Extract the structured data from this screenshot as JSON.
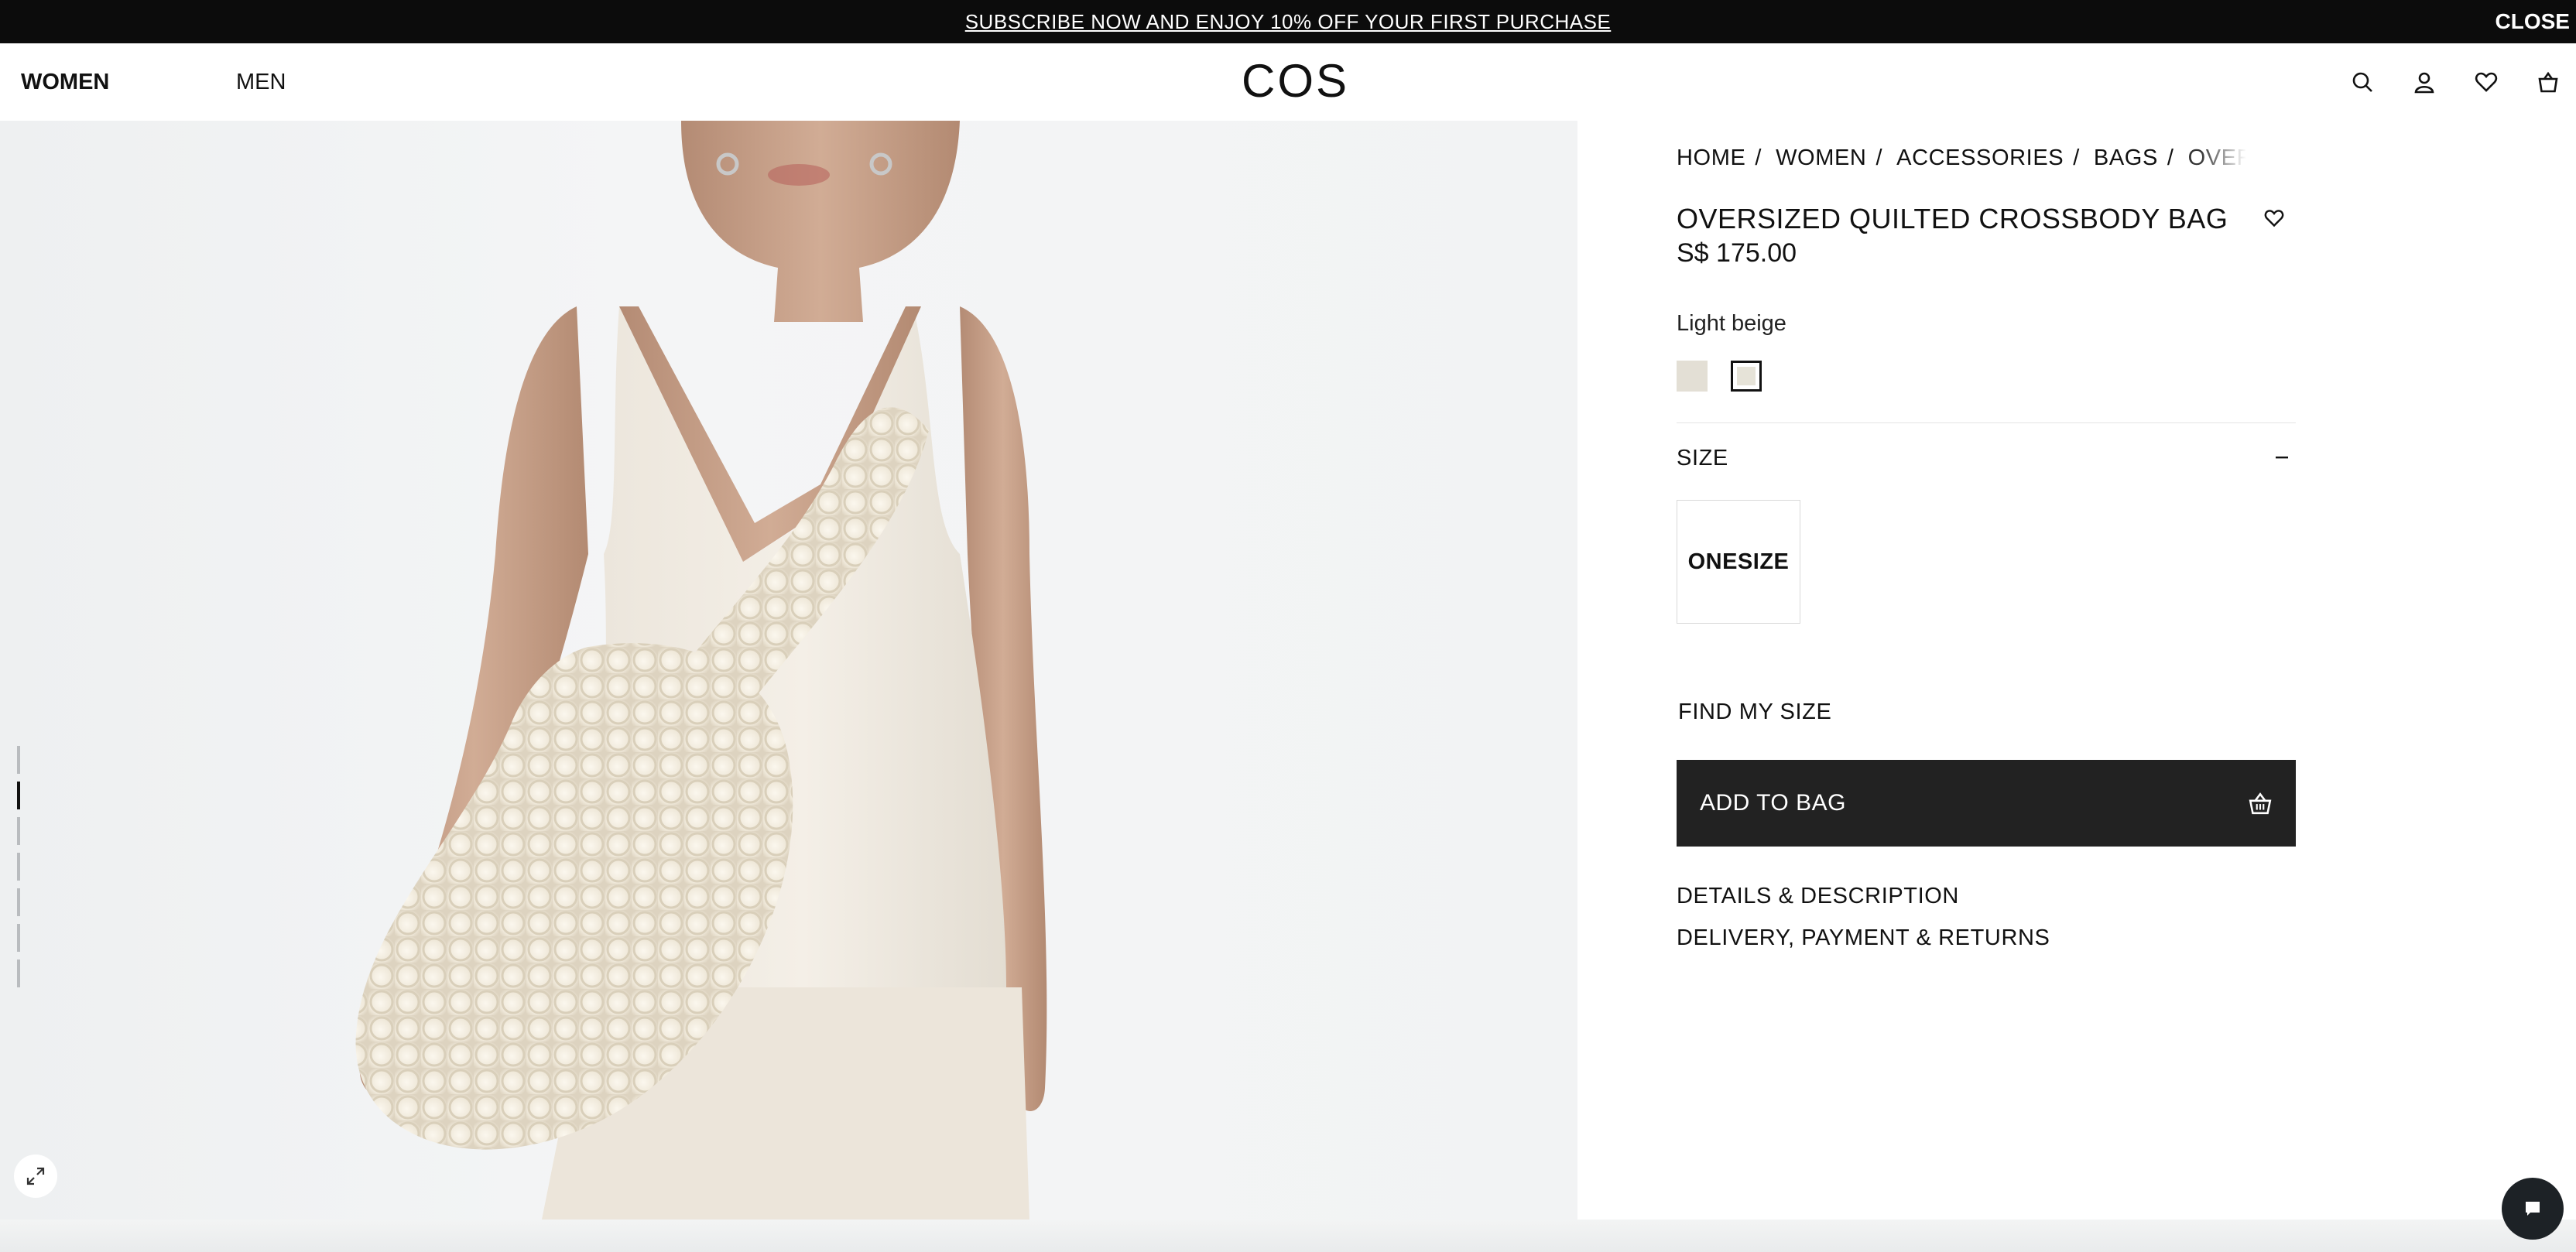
{
  "promo": {
    "text": "SUBSCRIBE NOW AND ENJOY 10% OFF YOUR FIRST PURCHASE",
    "close_label": "CLOSE"
  },
  "header": {
    "nav": [
      {
        "label": "WOMEN"
      },
      {
        "label": "MEN"
      }
    ],
    "logo": "COS",
    "icons": [
      "search-icon",
      "account-icon",
      "wishlist-heart-icon",
      "shopping-bag-icon"
    ]
  },
  "gallery": {
    "image": "model-wearing-oversized-quilted-crossbody-bag",
    "thumbnail_count": 7,
    "active_thumbnail": 2,
    "expand_icon": "expand-icon"
  },
  "product": {
    "breadcrumb": [
      {
        "label": "HOME"
      },
      {
        "label": "WOMEN"
      },
      {
        "label": "ACCESSORIES"
      },
      {
        "label": "BAGS"
      },
      {
        "label": "OVERSIZED QUILTED CROSSBODY BAG"
      }
    ],
    "title": "OVERSIZED QUILTED CROSSBODY BAG",
    "price": "S$ 175.00",
    "color_name": "Light beige",
    "swatches": [
      {
        "color": "#e3dfd5",
        "selected": false
      },
      {
        "color": "#e6e3d8",
        "selected": true
      }
    ],
    "size_section": {
      "title": "SIZE",
      "collapse_icon": "minus-icon",
      "options": [
        "ONESIZE"
      ]
    },
    "find_my_size": "FIND MY SIZE",
    "add_to_bag": "ADD TO BAG",
    "accordions": [
      {
        "label": "DETAILS & DESCRIPTION"
      },
      {
        "label": "DELIVERY, PAYMENT & RETURNS"
      }
    ]
  },
  "chat": {
    "icon": "chat-icon"
  },
  "colors": {
    "promo_bg": "#0c0c0c",
    "button_bg": "#222222",
    "gallery_bg": "#f1f2f3"
  }
}
